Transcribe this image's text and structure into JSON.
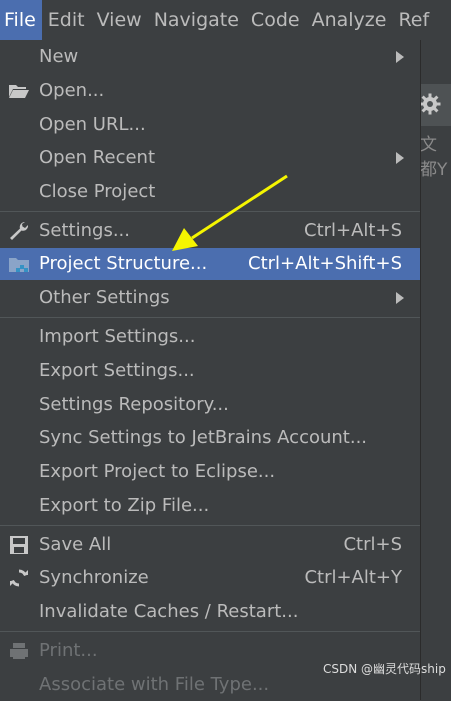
{
  "menubar": [
    "File",
    "Edit",
    "View",
    "Navigate",
    "Code",
    "Analyze",
    "Ref"
  ],
  "side_text": "文都Y",
  "items": [
    {
      "label": "New",
      "shortcut": ""
    },
    {
      "label": "Open...",
      "shortcut": ""
    },
    {
      "label": "Open URL...",
      "shortcut": ""
    },
    {
      "label": "Open Recent",
      "shortcut": ""
    },
    {
      "label": "Close Project",
      "shortcut": ""
    },
    {
      "label": "Settings...",
      "shortcut": "Ctrl+Alt+S"
    },
    {
      "label": "Project Structure...",
      "shortcut": "Ctrl+Alt+Shift+S"
    },
    {
      "label": "Other Settings",
      "shortcut": ""
    },
    {
      "label": "Import Settings...",
      "shortcut": ""
    },
    {
      "label": "Export Settings...",
      "shortcut": ""
    },
    {
      "label": "Settings Repository...",
      "shortcut": ""
    },
    {
      "label": "Sync Settings to JetBrains Account...",
      "shortcut": ""
    },
    {
      "label": "Export Project to Eclipse...",
      "shortcut": ""
    },
    {
      "label": "Export to Zip File...",
      "shortcut": ""
    },
    {
      "label": "Save All",
      "shortcut": "Ctrl+S"
    },
    {
      "label": "Synchronize",
      "shortcut": "Ctrl+Alt+Y"
    },
    {
      "label": "Invalidate Caches / Restart...",
      "shortcut": ""
    },
    {
      "label": "Print...",
      "shortcut": ""
    },
    {
      "label": "Associate with File Type...",
      "shortcut": ""
    }
  ],
  "watermark": "CSDN @幽灵代码ship",
  "colors": {
    "background": "#3c3f41",
    "selection": "#4b6eaf",
    "arrow": "#f5f500"
  }
}
